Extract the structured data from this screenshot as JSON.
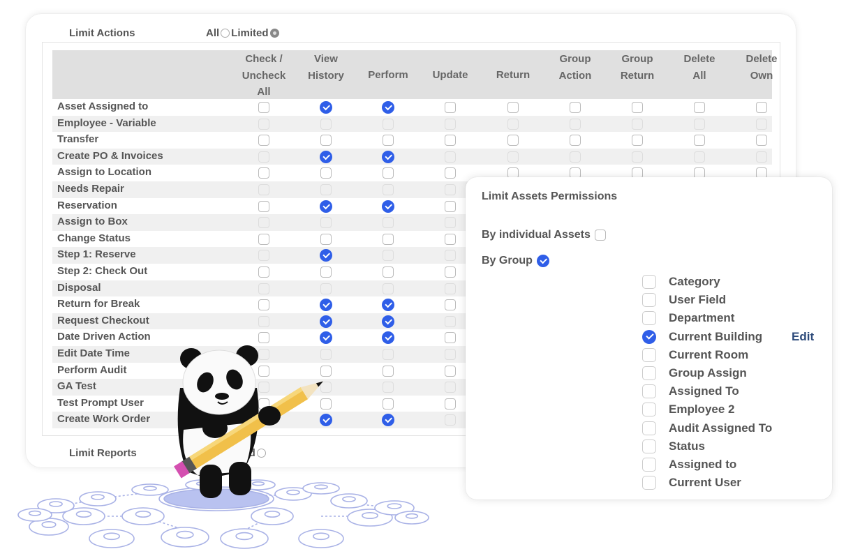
{
  "limit_actions": {
    "label": "Limit Actions",
    "options": [
      {
        "label": "All",
        "selected": false
      },
      {
        "label": "Limited",
        "selected": true
      }
    ]
  },
  "table": {
    "columns": [
      {
        "label_lines": [
          "Check /",
          "Uncheck",
          "All"
        ]
      },
      {
        "label_lines": [
          "View",
          "History"
        ]
      },
      {
        "label_lines": [
          "Perform"
        ]
      },
      {
        "label_lines": [
          "Update"
        ]
      },
      {
        "label_lines": [
          "Return"
        ]
      },
      {
        "label_lines": [
          "Group",
          "Action"
        ]
      },
      {
        "label_lines": [
          "Group",
          "Return"
        ]
      },
      {
        "label_lines": [
          "Delete",
          "All"
        ]
      },
      {
        "label_lines": [
          "Delete",
          "Own"
        ]
      }
    ],
    "rows": [
      {
        "label": "Asset Assigned to",
        "checks": [
          false,
          true,
          true,
          false,
          false,
          false,
          false,
          false,
          false
        ]
      },
      {
        "label": "Employee - Variable",
        "checks": [
          false,
          false,
          false,
          false,
          false,
          false,
          false,
          false,
          false
        ]
      },
      {
        "label": "Transfer",
        "checks": [
          false,
          false,
          false,
          false,
          false,
          false,
          false,
          false,
          false
        ]
      },
      {
        "label": "Create PO & Invoices",
        "checks": [
          false,
          true,
          true,
          false,
          false,
          false,
          false,
          false,
          false
        ]
      },
      {
        "label": "Assign to Location",
        "checks": [
          false,
          false,
          false,
          false,
          false,
          false,
          false,
          false,
          false
        ]
      },
      {
        "label": "Needs Repair",
        "checks": [
          false,
          false,
          false,
          false,
          false,
          false,
          false,
          false,
          false
        ]
      },
      {
        "label": "Reservation",
        "checks": [
          false,
          true,
          true,
          false,
          false,
          false,
          false,
          false,
          false
        ]
      },
      {
        "label": "Assign to Box",
        "checks": [
          false,
          false,
          false,
          false,
          false,
          false,
          false,
          false,
          false
        ]
      },
      {
        "label": "Change Status",
        "checks": [
          false,
          false,
          false,
          false,
          false,
          false,
          false,
          false,
          false
        ]
      },
      {
        "label": "Step 1: Reserve",
        "checks": [
          false,
          true,
          false,
          false,
          false,
          false,
          false,
          false,
          false
        ]
      },
      {
        "label": "Step 2: Check Out",
        "checks": [
          false,
          false,
          false,
          false,
          false,
          false,
          false,
          false,
          false
        ]
      },
      {
        "label": "Disposal",
        "checks": [
          false,
          false,
          false,
          false,
          false,
          false,
          false,
          false,
          false
        ]
      },
      {
        "label": "Return for Break",
        "checks": [
          false,
          true,
          true,
          false,
          false,
          false,
          false,
          false,
          false
        ]
      },
      {
        "label": "Request Checkout",
        "checks": [
          false,
          true,
          true,
          false,
          false,
          false,
          false,
          false,
          false
        ]
      },
      {
        "label": "Date Driven Action",
        "checks": [
          false,
          true,
          true,
          false,
          false,
          false,
          false,
          false,
          false
        ]
      },
      {
        "label": "Edit Date Time",
        "checks": [
          false,
          false,
          false,
          false,
          false,
          false,
          false,
          false,
          false
        ]
      },
      {
        "label": "Perform Audit",
        "checks": [
          false,
          false,
          false,
          false,
          false,
          false,
          false,
          false,
          false
        ]
      },
      {
        "label": "GA Test",
        "checks": [
          false,
          false,
          false,
          false,
          false,
          false,
          false,
          false,
          false
        ]
      },
      {
        "label": "Test Prompt User",
        "checks": [
          false,
          false,
          false,
          false,
          false,
          false,
          false,
          false,
          false
        ]
      },
      {
        "label": "Create Work Order",
        "checks": [
          false,
          true,
          true,
          false,
          false,
          false,
          false,
          false,
          false
        ]
      }
    ]
  },
  "limit_reports": {
    "label": "Limit Reports",
    "visible_option": "Limited",
    "visible_option_partial": "nited",
    "selected": false
  },
  "assets_panel": {
    "title": "Limit Assets Permissions",
    "by_individual": {
      "label": "By individual Assets",
      "checked": false
    },
    "by_group": {
      "label": "By Group",
      "checked": true
    },
    "edit_label": "Edit",
    "groups": [
      {
        "label": "Category",
        "checked": false
      },
      {
        "label": "User Field",
        "checked": false
      },
      {
        "label": "Department",
        "checked": false
      },
      {
        "label": "Current Building",
        "checked": true,
        "editable": true
      },
      {
        "label": "Current Room",
        "checked": false
      },
      {
        "label": "Group Assign",
        "checked": false
      },
      {
        "label": "Assigned To",
        "checked": false
      },
      {
        "label": "Employee 2",
        "checked": false
      },
      {
        "label": "Audit Assigned To",
        "checked": false
      },
      {
        "label": "Status",
        "checked": false
      },
      {
        "label": "Assigned to",
        "checked": false
      },
      {
        "label": "Current User",
        "checked": false
      }
    ]
  },
  "colors": {
    "accent": "#2f5ee8",
    "edit_link": "#2d4a7a",
    "header_bg": "#e0e0e0",
    "alt_row_bg": "#f0f0f0",
    "text": "#555555",
    "network": "#a9b2e6"
  },
  "illustration": {
    "mascot": "panda-holding-pencil",
    "background": "user-network-graph"
  }
}
